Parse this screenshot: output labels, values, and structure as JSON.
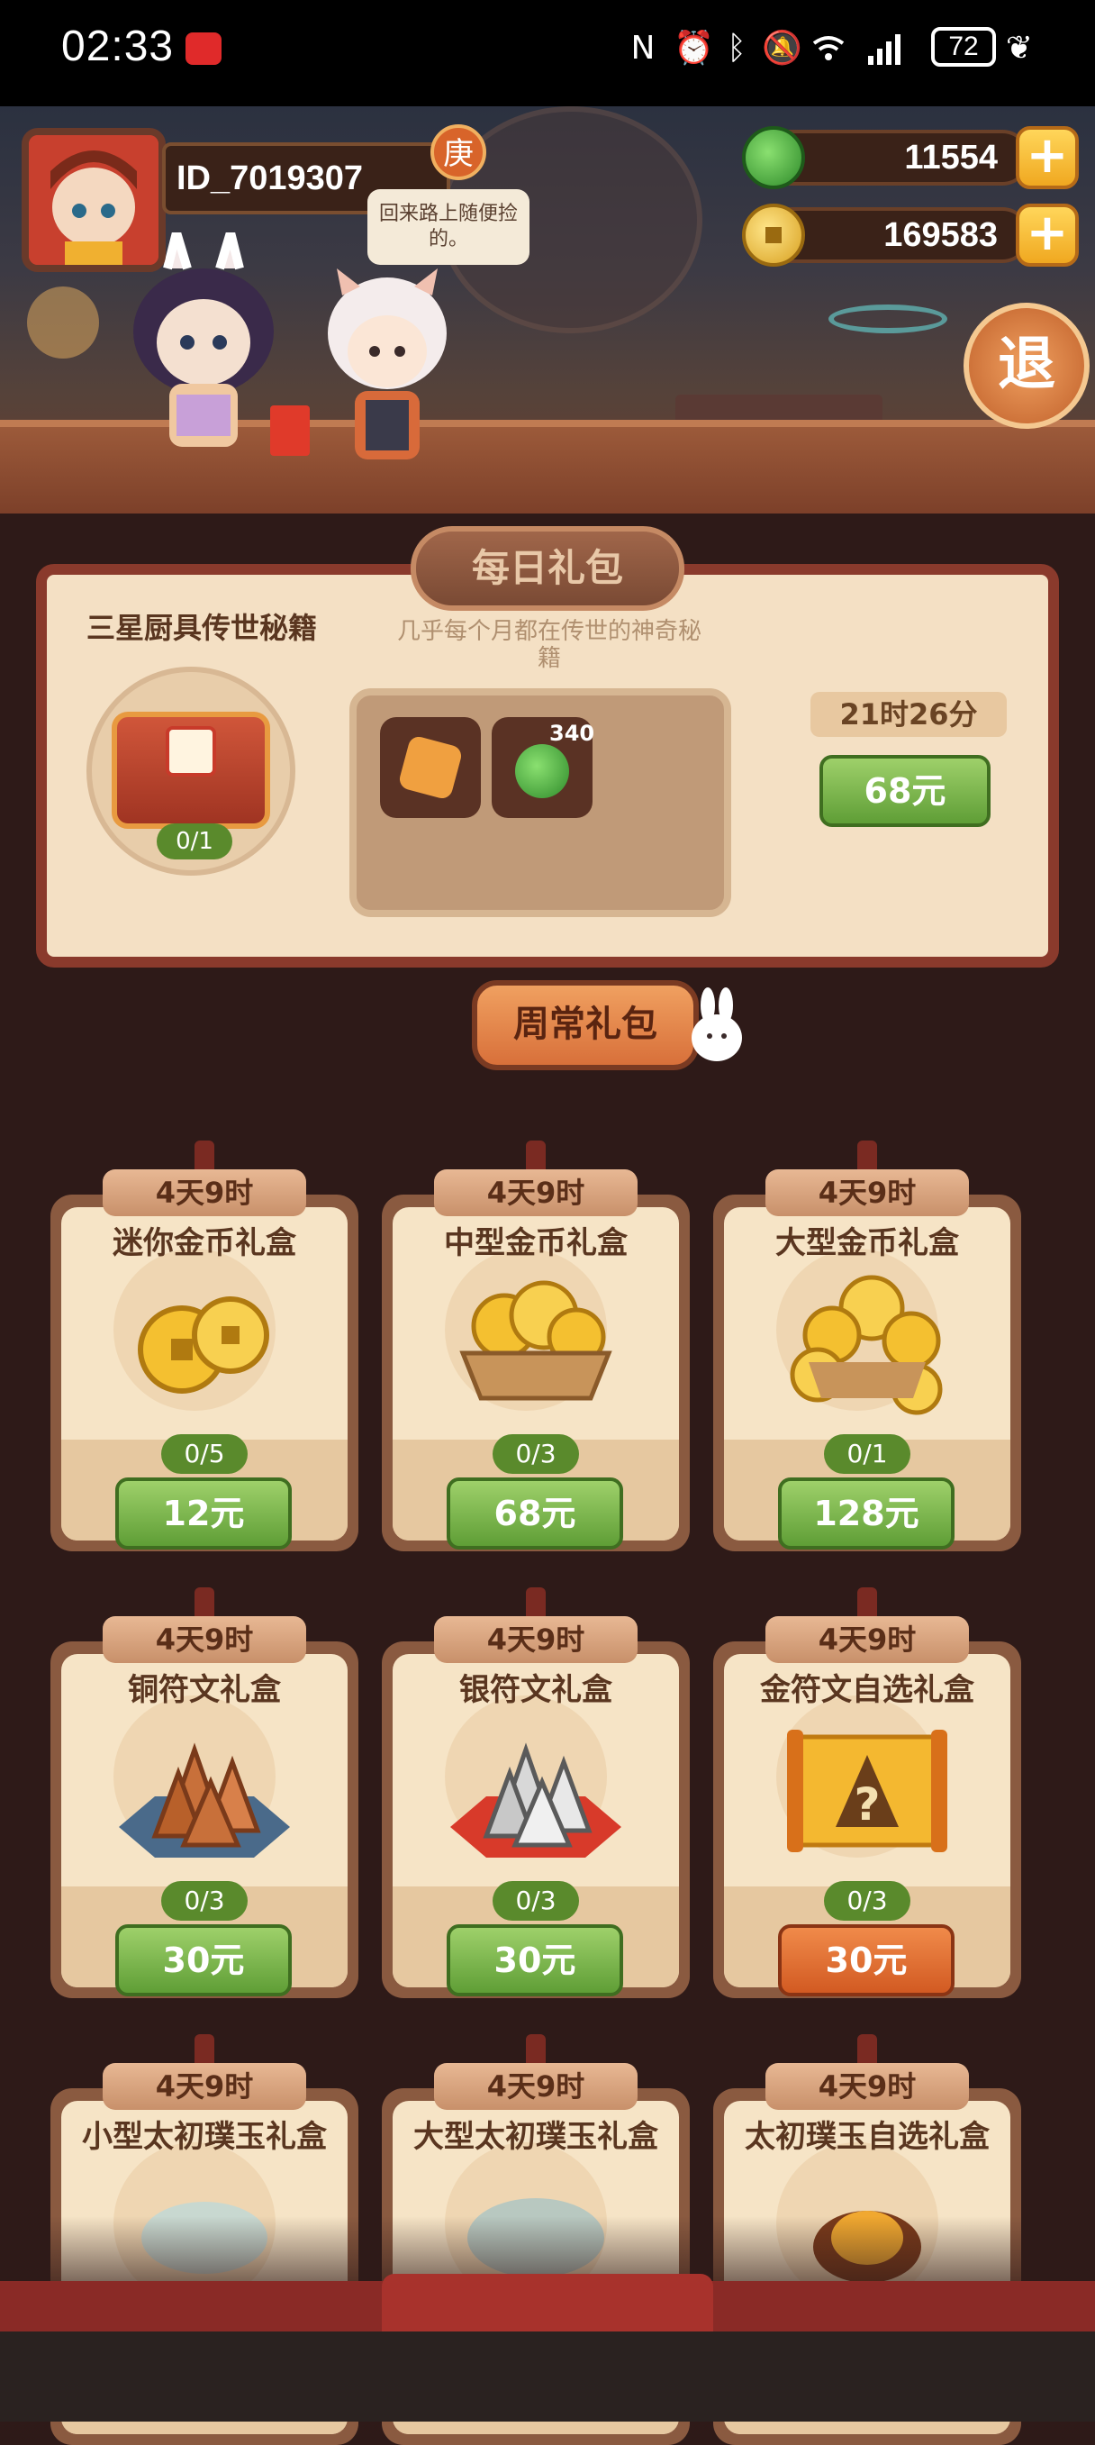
{
  "status_bar": {
    "time": "02:33",
    "battery": "72",
    "icons": [
      "nfc-icon",
      "alarm-icon",
      "bluetooth-icon",
      "mute-icon",
      "wifi-icon",
      "signal-icon",
      "battery-saver-icon"
    ]
  },
  "player": {
    "id": "ID_7019307",
    "rank_badge": "庚",
    "speech": "回来路上随便捡的。"
  },
  "currency": {
    "jade": "11554",
    "coins": "169583",
    "exit_label": "退"
  },
  "daily": {
    "title": "每日礼包",
    "pack_name": "三星厨具传世秘籍",
    "pack_desc": "几乎每个月都在传世的神奇秘籍",
    "progress": "0/1",
    "reward_qty": "340",
    "timer": "21时26分",
    "price": "68元"
  },
  "weekly": {
    "title": "周常礼包",
    "cards": [
      {
        "timer": "4天9时",
        "title": "迷你金币礼盒",
        "count": "0/5",
        "price": "12元",
        "button": "green",
        "art": "coins-small"
      },
      {
        "timer": "4天9时",
        "title": "中型金币礼盒",
        "count": "0/3",
        "price": "68元",
        "button": "green",
        "art": "coins-basket"
      },
      {
        "timer": "4天9时",
        "title": "大型金币礼盒",
        "count": "0/1",
        "price": "128元",
        "button": "green",
        "art": "coins-pile"
      },
      {
        "timer": "4天9时",
        "title": "铜符文礼盒",
        "count": "0/3",
        "price": "30元",
        "button": "green",
        "art": "copper-runes"
      },
      {
        "timer": "4天9时",
        "title": "银符文礼盒",
        "count": "0/3",
        "price": "30元",
        "button": "green",
        "art": "silver-runes"
      },
      {
        "timer": "4天9时",
        "title": "金符文自选礼盒",
        "count": "0/3",
        "price": "30元",
        "button": "orange",
        "art": "gold-rune-scroll"
      },
      {
        "timer": "4天9时",
        "title": "小型太初璞玉礼盒",
        "art": "jade-small"
      },
      {
        "timer": "4天9时",
        "title": "大型太初璞玉礼盒",
        "art": "jade-large"
      },
      {
        "timer": "4天9时",
        "title": "太初璞玉自选礼盒",
        "art": "jade-select"
      }
    ]
  },
  "colors": {
    "green_button": "#6aa83c",
    "orange_button": "#e06a2c",
    "panel_border": "#8a3a2c",
    "background": "#2e1a18"
  }
}
